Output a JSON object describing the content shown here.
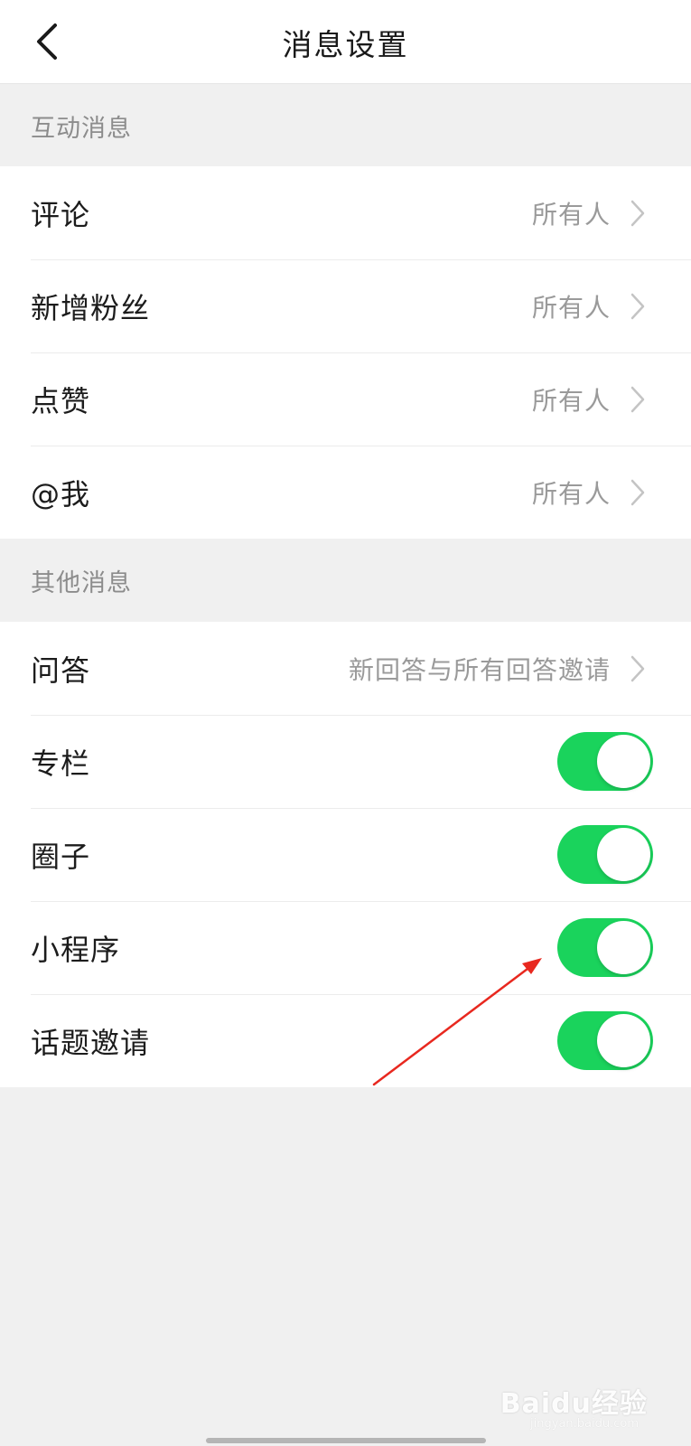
{
  "header": {
    "title": "消息设置",
    "back_icon": "chevron-left-icon"
  },
  "sections": [
    {
      "title": "互动消息",
      "items": [
        {
          "label": "评论",
          "value": "所有人",
          "control": "chevron"
        },
        {
          "label": "新增粉丝",
          "value": "所有人",
          "control": "chevron"
        },
        {
          "label": "点赞",
          "value": "所有人",
          "control": "chevron"
        },
        {
          "label": "@我",
          "value": "所有人",
          "control": "chevron"
        }
      ]
    },
    {
      "title": "其他消息",
      "items": [
        {
          "label": "问答",
          "value": "新回答与所有回答邀请",
          "control": "chevron"
        },
        {
          "label": "专栏",
          "control": "toggle",
          "on": true
        },
        {
          "label": "圈子",
          "control": "toggle",
          "on": true
        },
        {
          "label": "小程序",
          "control": "toggle",
          "on": true
        },
        {
          "label": "话题邀请",
          "control": "toggle",
          "on": true
        }
      ]
    }
  ],
  "watermark": {
    "text": "Baidu经验",
    "sub": "jingyan.baidu.com"
  },
  "colors": {
    "toggle_on": "#1ad35c",
    "annotation_arrow": "#e8281f",
    "background": "#f0f0f0"
  }
}
